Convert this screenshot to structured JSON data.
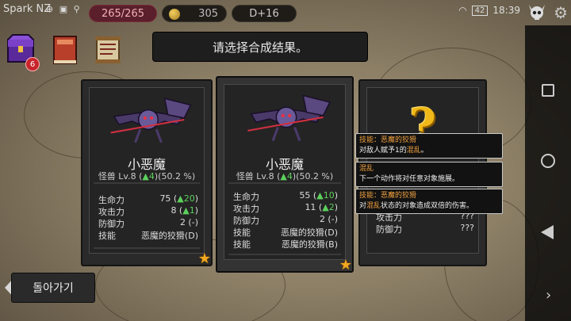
{
  "status": {
    "app_name": "Spark NZ",
    "hp": "265/265",
    "gold": "305",
    "depth": "D+16",
    "battery": "42",
    "time": "18:39"
  },
  "inventory_badge": "6",
  "title": "请选择合成结果。",
  "cards": [
    {
      "name": "小恶魔",
      "level_prefix": "怪兽 Lv.8 (",
      "level_up": "▲4",
      "level_suffix": ")",
      "percent": "(50.2 %)",
      "stats": [
        {
          "label": "生命力",
          "value": "75 (",
          "up": "▲20",
          "close": ")"
        },
        {
          "label": "攻击力",
          "value": "8 (",
          "up": "▲1",
          "close": ")"
        },
        {
          "label": "防御力",
          "value": "2 (-)",
          "up": "",
          "close": ""
        },
        {
          "label": "技能",
          "value": "恶魔的狡猾(D)",
          "up": "",
          "close": ""
        }
      ]
    },
    {
      "name": "小恶魔",
      "level_prefix": "怪兽 Lv.8 (",
      "level_up": "▲4",
      "level_suffix": ")",
      "percent": "(50.2 %)",
      "stats": [
        {
          "label": "生命力",
          "value": "55 (",
          "up": "▲10",
          "close": ")"
        },
        {
          "label": "攻击力",
          "value": "11 (",
          "up": "▲2",
          "close": ")"
        },
        {
          "label": "防御力",
          "value": "2 (-)",
          "up": "",
          "close": ""
        },
        {
          "label": "技能",
          "value": "恶魔的狡猾(D)",
          "up": "",
          "close": ""
        },
        {
          "label": "技能",
          "value": "恶魔的狡猾(B)",
          "up": "",
          "close": ""
        }
      ]
    }
  ],
  "mystery_card": {
    "stat1_label": "攻击力",
    "stat1_value": "???",
    "stat2_label": "防御力",
    "stat2_value": "???"
  },
  "tooltips": [
    {
      "head": "技能：恶魔的狡猾",
      "body_pre": "对敌人赋予1的",
      "hl": "混乱",
      "body_post": "。"
    },
    {
      "head": "混乱",
      "body_pre": "下一个动作将对任意对象施展。",
      "hl": "",
      "body_post": ""
    },
    {
      "head": "技能：恶魔的狡猾",
      "body_pre": "对",
      "hl": "混乱",
      "body_post": "状态的对象造成双倍的伤害。"
    }
  ],
  "back_button": "돌아가기",
  "colors": {
    "stat_up": "#5cd05c",
    "star": "#f0a820",
    "hp_pill": "#5a1f2a",
    "tip_head": "#f0a040"
  }
}
